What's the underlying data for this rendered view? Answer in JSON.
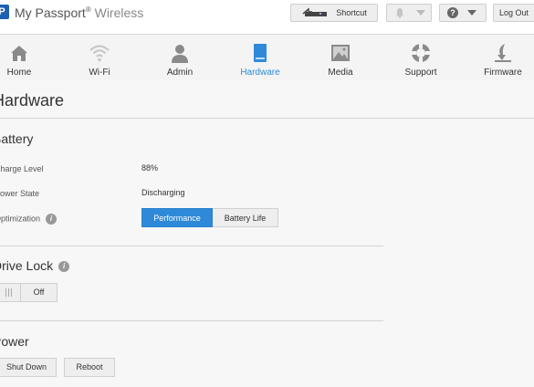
{
  "header": {
    "logo_letter": "P",
    "brand_name": "My Passport",
    "brand_reg": "®",
    "brand_suffix": "Wireless",
    "shortcut_label": "Shortcut",
    "logout_label": "Log Out",
    "help_glyph": "?"
  },
  "nav": {
    "items": [
      {
        "label": "Home",
        "icon": "home-icon"
      },
      {
        "label": "Wi-Fi",
        "icon": "wifi-icon"
      },
      {
        "label": "Admin",
        "icon": "admin-icon"
      },
      {
        "label": "Hardware",
        "icon": "hardware-icon",
        "active": true
      },
      {
        "label": "Media",
        "icon": "media-icon"
      },
      {
        "label": "Support",
        "icon": "support-icon"
      },
      {
        "label": "Firmware",
        "icon": "firmware-icon"
      }
    ]
  },
  "page": {
    "title": "Hardware"
  },
  "battery": {
    "title": "Battery",
    "charge_label": "Charge Level",
    "charge_value": "88%",
    "power_label": "Power State",
    "power_value": "Discharging",
    "opt_label": "Optimization",
    "opt_options": [
      "Performance",
      "Battery Life"
    ],
    "opt_selected": "Performance"
  },
  "drivelock": {
    "title": "Drive Lock",
    "state": "Off"
  },
  "power": {
    "title": "Power",
    "shutdown_label": "Shut Down",
    "reboot_label": "Reboot"
  },
  "colors": {
    "accent": "#2e8ad8",
    "brand": "#1d5fb0"
  }
}
